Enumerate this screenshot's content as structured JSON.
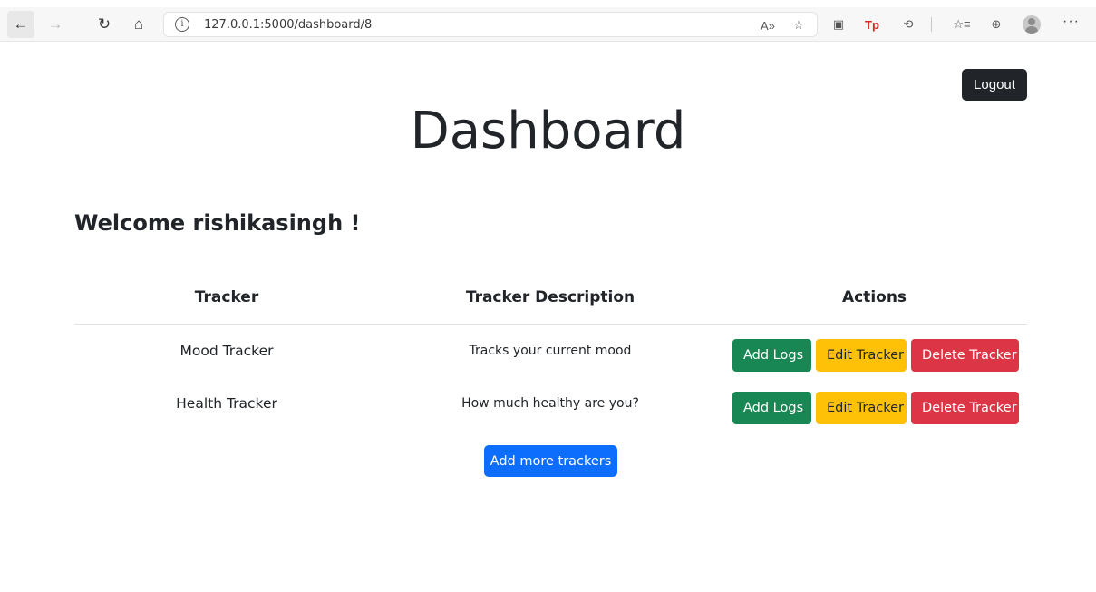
{
  "browser": {
    "url": "127.0.0.1:5000/dashboard/8",
    "icons": {
      "back": "←",
      "forward": "→",
      "reload": "↻",
      "home": "⌂",
      "info": "i",
      "read_aloud": "A»",
      "favorite": "☆",
      "extension": "▣",
      "tp_extension": "Tp",
      "extensions_puzzle": "⟲",
      "favorites": "☆≡",
      "collections": "⊕",
      "more": "···"
    }
  },
  "page": {
    "logout_label": "Logout",
    "title": "Dashboard",
    "welcome": "Welcome rishikasingh !",
    "table": {
      "headers": [
        "Tracker",
        "Tracker Description",
        "Actions"
      ],
      "rows": [
        {
          "tracker": "Mood Tracker",
          "description": "Tracks your current mood",
          "actions": [
            "Add Logs",
            "Edit Tracker",
            "Delete Tracker"
          ]
        },
        {
          "tracker": "Health Tracker",
          "description": "How much healthy are you?",
          "actions": [
            "Add Logs",
            "Edit Tracker",
            "Delete Tracker"
          ]
        }
      ]
    },
    "add_more_label": "Add more trackers"
  },
  "colors": {
    "dark": "#212529",
    "success": "#198754",
    "warning": "#ffc107",
    "danger": "#dc3545",
    "primary": "#0d6efd"
  }
}
